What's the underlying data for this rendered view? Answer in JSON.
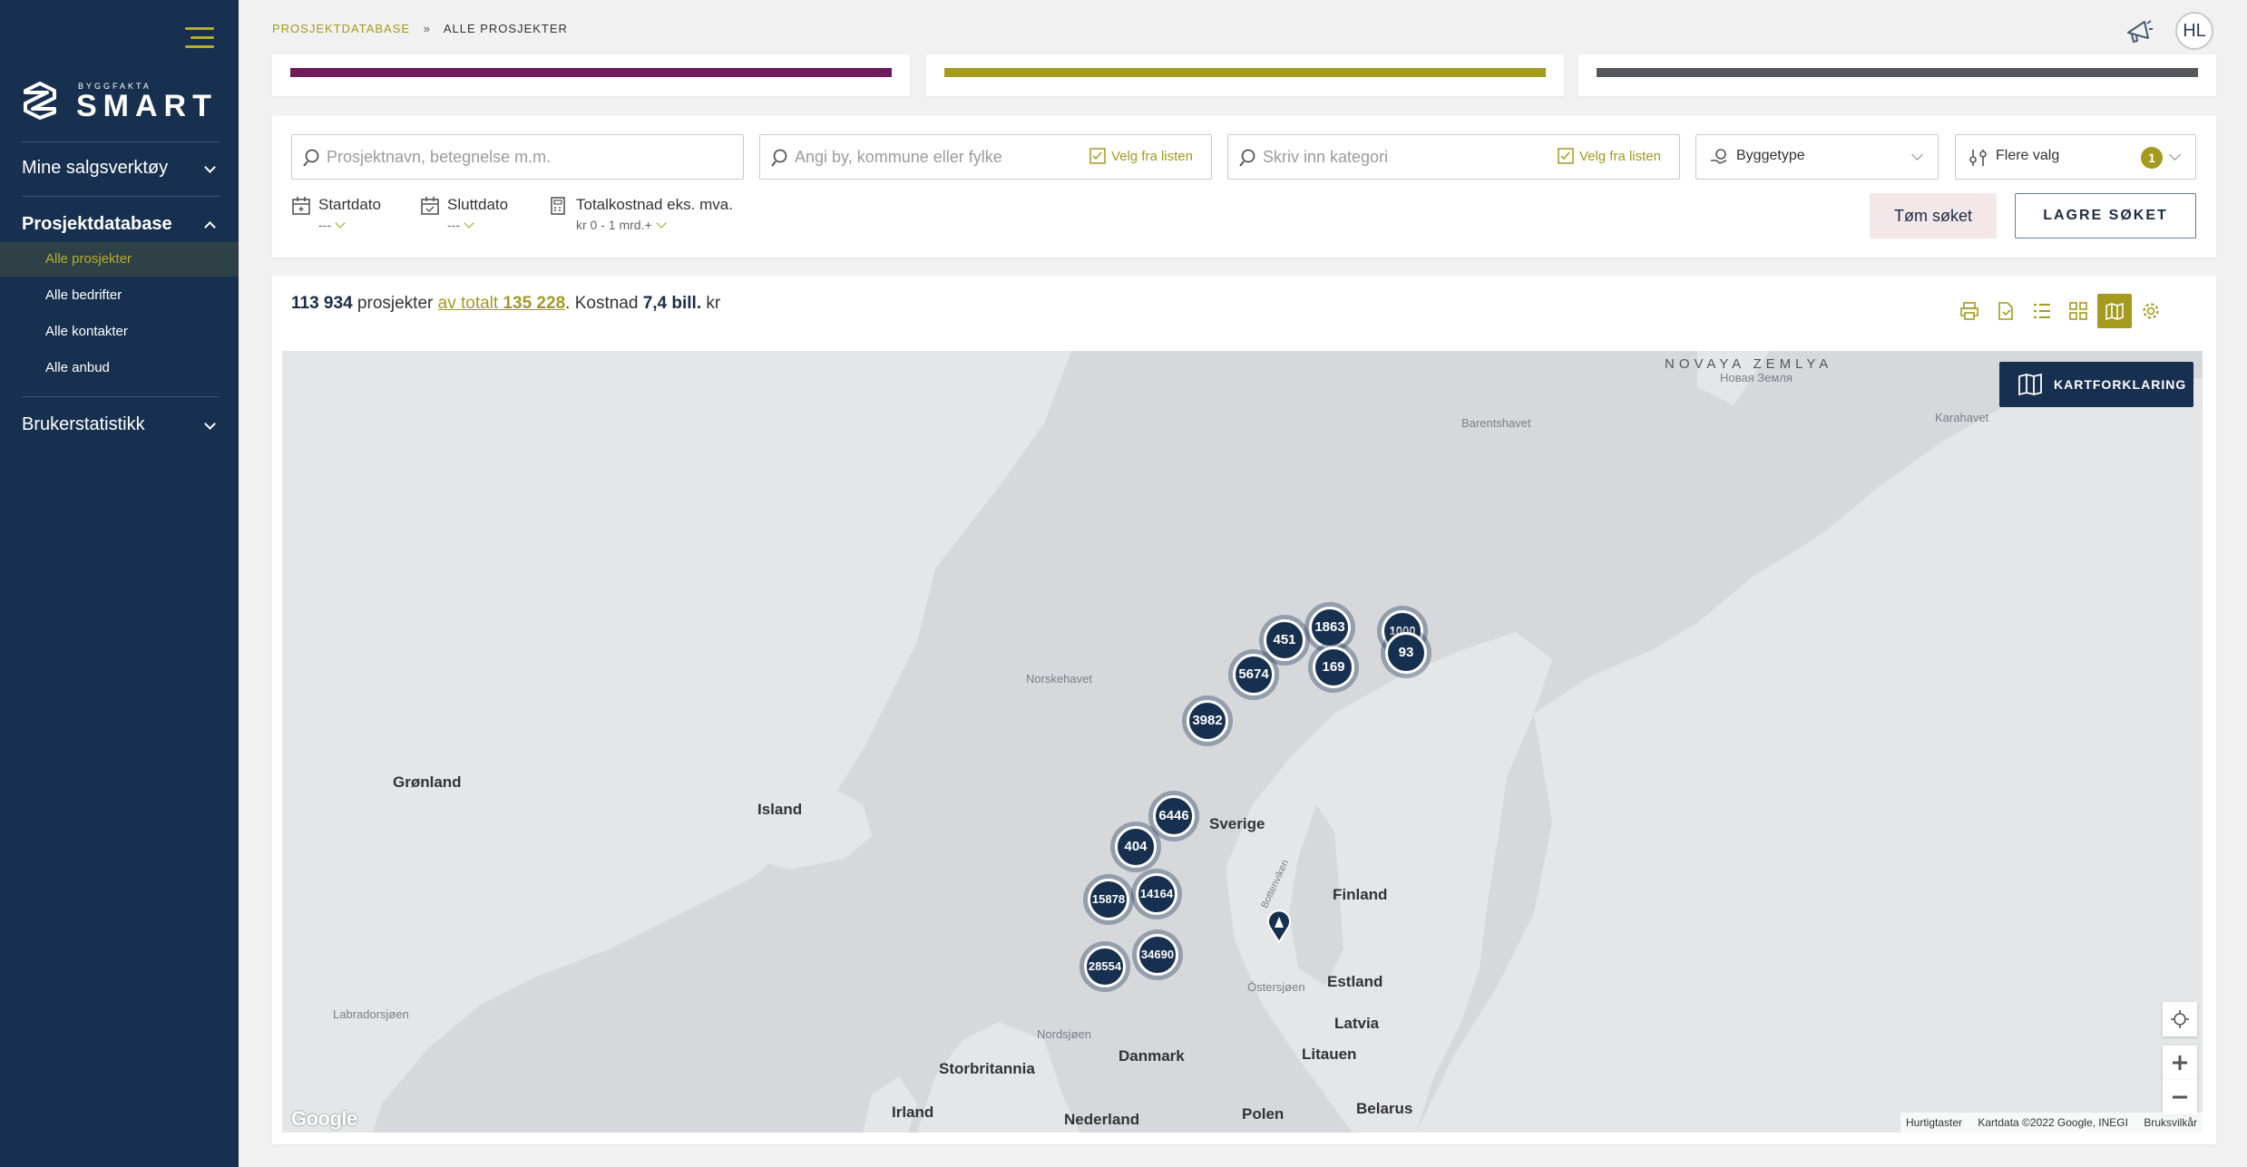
{
  "sidebar": {
    "logo_small": "BYGGFAKTA",
    "logo_text": "SMART",
    "sections": [
      {
        "label": "Mine salgsverktøy"
      },
      {
        "label": "Prosjektdatabase"
      },
      {
        "label": "Brukerstatistikk"
      }
    ],
    "items": [
      {
        "label": "Alle prosjekter"
      },
      {
        "label": "Alle bedrifter"
      },
      {
        "label": "Alle kontakter"
      },
      {
        "label": "Alle anbud"
      }
    ]
  },
  "header": {
    "breadcrumb_root": "PROSJEKTDATABASE",
    "breadcrumb_sep": "»",
    "breadcrumb_current": "ALLE PROSJEKTER",
    "avatar_initials": "HL"
  },
  "colors": {
    "navy": "#17304f",
    "accent": "#a39a1e",
    "bar_purple": "#6e1a5b",
    "bar_olive": "#a39a1e",
    "bar_gray": "#54575c"
  },
  "filters": {
    "project_placeholder": "Prosjektnavn, betegnelse m.m.",
    "location_placeholder": "Angi by, kommune eller fylke",
    "category_placeholder": "Skriv inn kategori",
    "pick_from_list": "Velg fra listen",
    "building_type": "Byggetype",
    "more_options": "Flere valg",
    "more_options_count": "1",
    "start_label": "Startdato",
    "start_value": "---",
    "end_label": "Sluttdato",
    "end_value": "---",
    "cost_label": "Totalkostnad eks. mva.",
    "cost_value": "kr 0 - 1 mrd.+",
    "clear_button": "Tøm søket",
    "save_button": "LAGRE SØKET"
  },
  "summary": {
    "count": "113 934",
    "projects_word": "prosjekter",
    "of_total_text": "av totalt",
    "total": "135 228",
    "cost_prefix": ". Kostnad",
    "cost": "7,4 bill.",
    "currency": "kr"
  },
  "map": {
    "legend_button": "KARTFORKLARING",
    "labels": [
      {
        "text": "NOVAYA ZEMLYA"
      },
      {
        "text": "Новая Земля"
      },
      {
        "text": "Barentshavet"
      },
      {
        "text": "Karahavet"
      },
      {
        "text": "Norskehavet"
      },
      {
        "text": "Grønland"
      },
      {
        "text": "Island"
      },
      {
        "text": "Sverige"
      },
      {
        "text": "Finland"
      },
      {
        "text": "Bottenviken"
      },
      {
        "text": "Östersjøen"
      },
      {
        "text": "Estland"
      },
      {
        "text": "Latvia"
      },
      {
        "text": "Litauen"
      },
      {
        "text": "Nordsjøen"
      },
      {
        "text": "Danmark"
      },
      {
        "text": "Storbritannia"
      },
      {
        "text": "Irland"
      },
      {
        "text": "Nederland"
      },
      {
        "text": "Polen"
      },
      {
        "text": "Belarus"
      },
      {
        "text": "Labradorsjøen"
      }
    ],
    "clusters": [
      {
        "count": "1863"
      },
      {
        "count": "451"
      },
      {
        "count": "169"
      },
      {
        "count": "1000"
      },
      {
        "count": "93"
      },
      {
        "count": "5674"
      },
      {
        "count": "3982"
      },
      {
        "count": "6446"
      },
      {
        "count": "404"
      },
      {
        "count": "15878"
      },
      {
        "count": "14164"
      },
      {
        "count": "34690"
      },
      {
        "count": "28554"
      }
    ],
    "google_logo": "Google",
    "attribution": {
      "shortcuts": "Hurtigtaster",
      "mapdata": "Kartdata ©2022 Google, INEGI",
      "terms": "Bruksvilkår"
    }
  }
}
